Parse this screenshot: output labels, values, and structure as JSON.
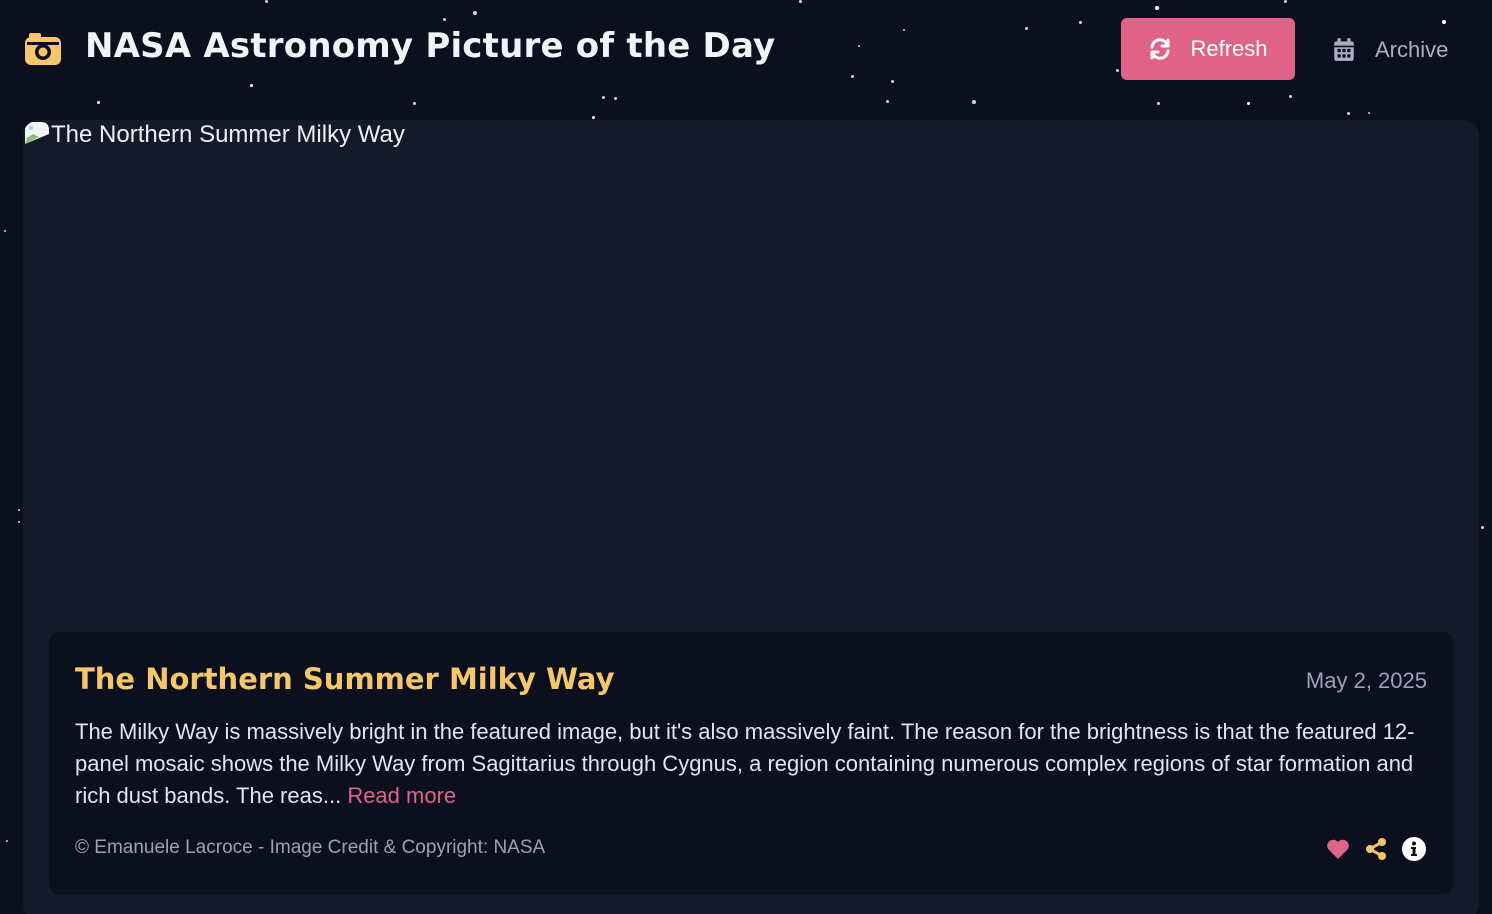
{
  "header": {
    "app_title": "NASA Astronomy Picture of the Day",
    "refresh_label": "Refresh",
    "archive_label": "Archive"
  },
  "photo": {
    "alt_text": "The Northern Summer Milky Way",
    "title": "The Northern Summer Milky Way",
    "date": "May 2, 2025",
    "description": "The Milky Way is massively bright in the featured image, but it's also massively faint. The reason for the brightness is that the featured 12-panel mosaic shows the Milky Way from Sagittarius through Cygnus, a region containing numerous complex regions of star formation and rich dust bands. The reas...",
    "read_more_label": "Read more",
    "credit": "© Emanuele Lacroce - Image Credit & Copyright: NASA"
  },
  "icons": {
    "logo": "camera-icon",
    "refresh": "refresh-icon",
    "archive": "calendar-icon",
    "like": "heart-icon",
    "share": "share-icon",
    "info": "info-icon"
  },
  "colors": {
    "background": "#0b0f1e",
    "card": "#151a2a",
    "accent_pink": "#e06389",
    "accent_gold": "#f5c66b",
    "muted_text": "#9aa3b8"
  }
}
